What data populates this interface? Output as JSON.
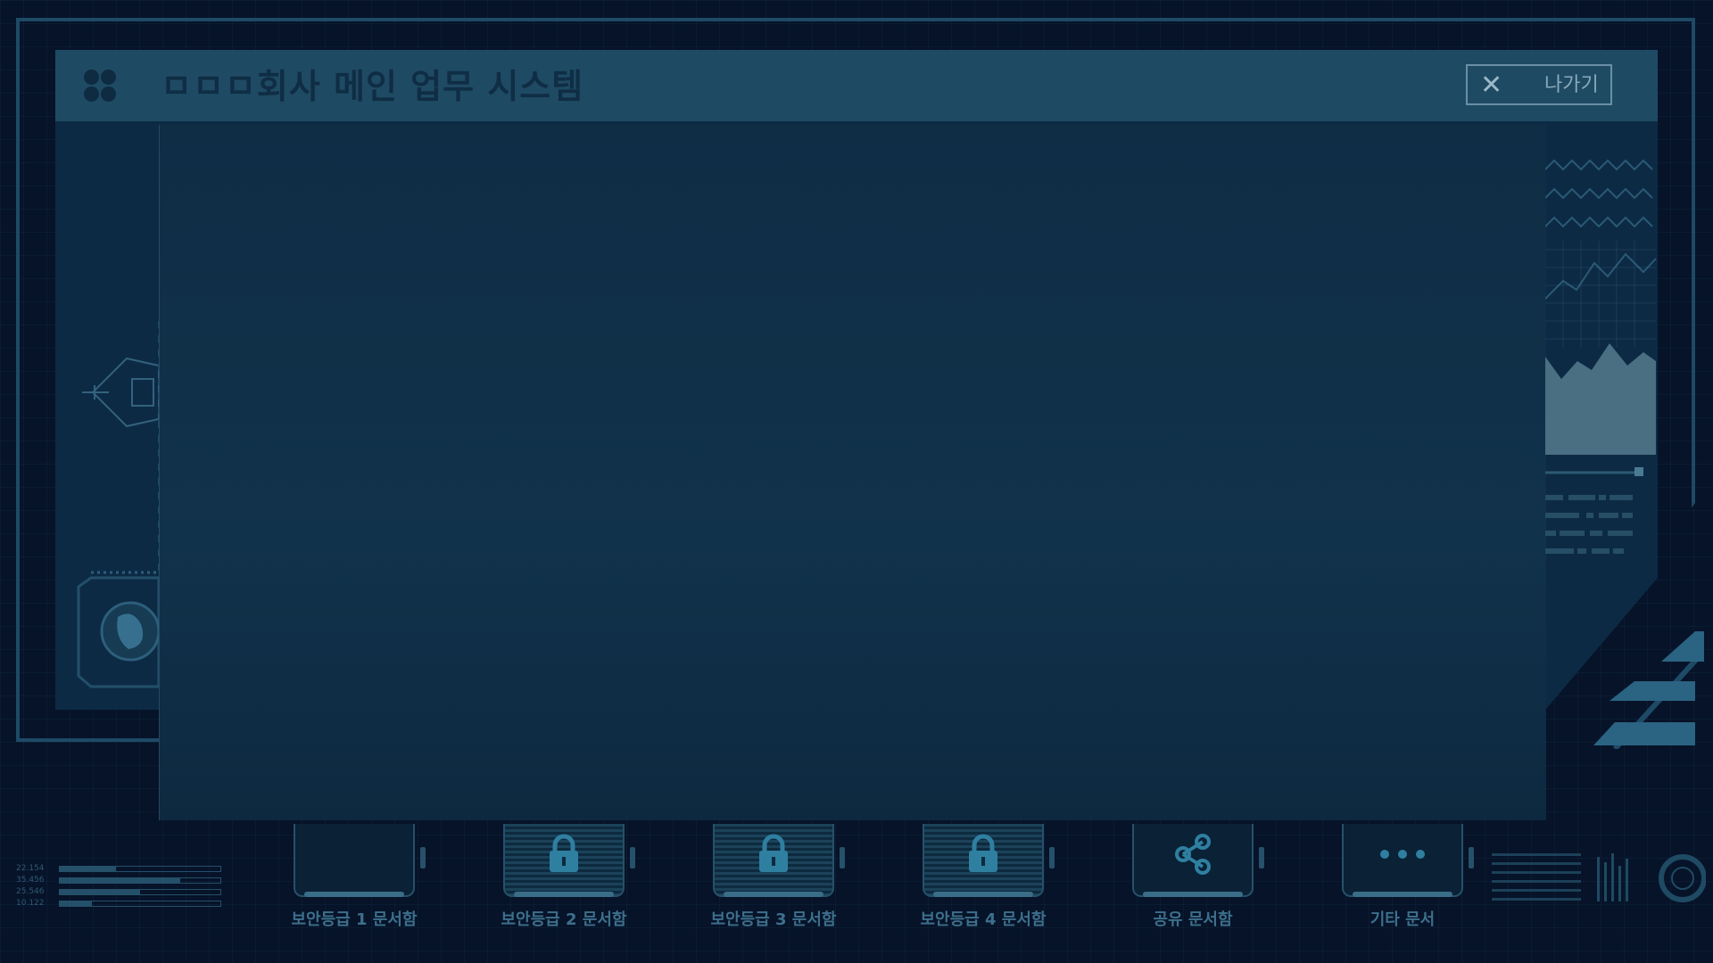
{
  "window": {
    "title": "ㅁㅁㅁ회사 메인 업무 시스템",
    "exit_label": "나가기"
  },
  "folders": [
    {
      "label": "보안등급 1 문서함",
      "icon": "folder-icon",
      "locked": false
    },
    {
      "label": "보안등급 2 문서함",
      "icon": "lock-icon",
      "locked": true
    },
    {
      "label": "보안등급 3 문서함",
      "icon": "lock-icon",
      "locked": true
    },
    {
      "label": "보안등급 4 문서함",
      "icon": "lock-icon",
      "locked": true
    },
    {
      "label": "공유 문서함",
      "icon": "share-icon",
      "locked": false
    },
    {
      "label": "기타 문서",
      "icon": "more-icon",
      "locked": false
    }
  ],
  "stats": [
    {
      "value": "22.154",
      "fill": 0.35
    },
    {
      "value": "35.456",
      "fill": 0.75
    },
    {
      "value": "25.546",
      "fill": 0.5
    },
    {
      "value": "10.122",
      "fill": 0.2
    }
  ],
  "colors": {
    "background": "#061328",
    "title_bar": "#1f4a63",
    "accent": "#3a6d88"
  }
}
